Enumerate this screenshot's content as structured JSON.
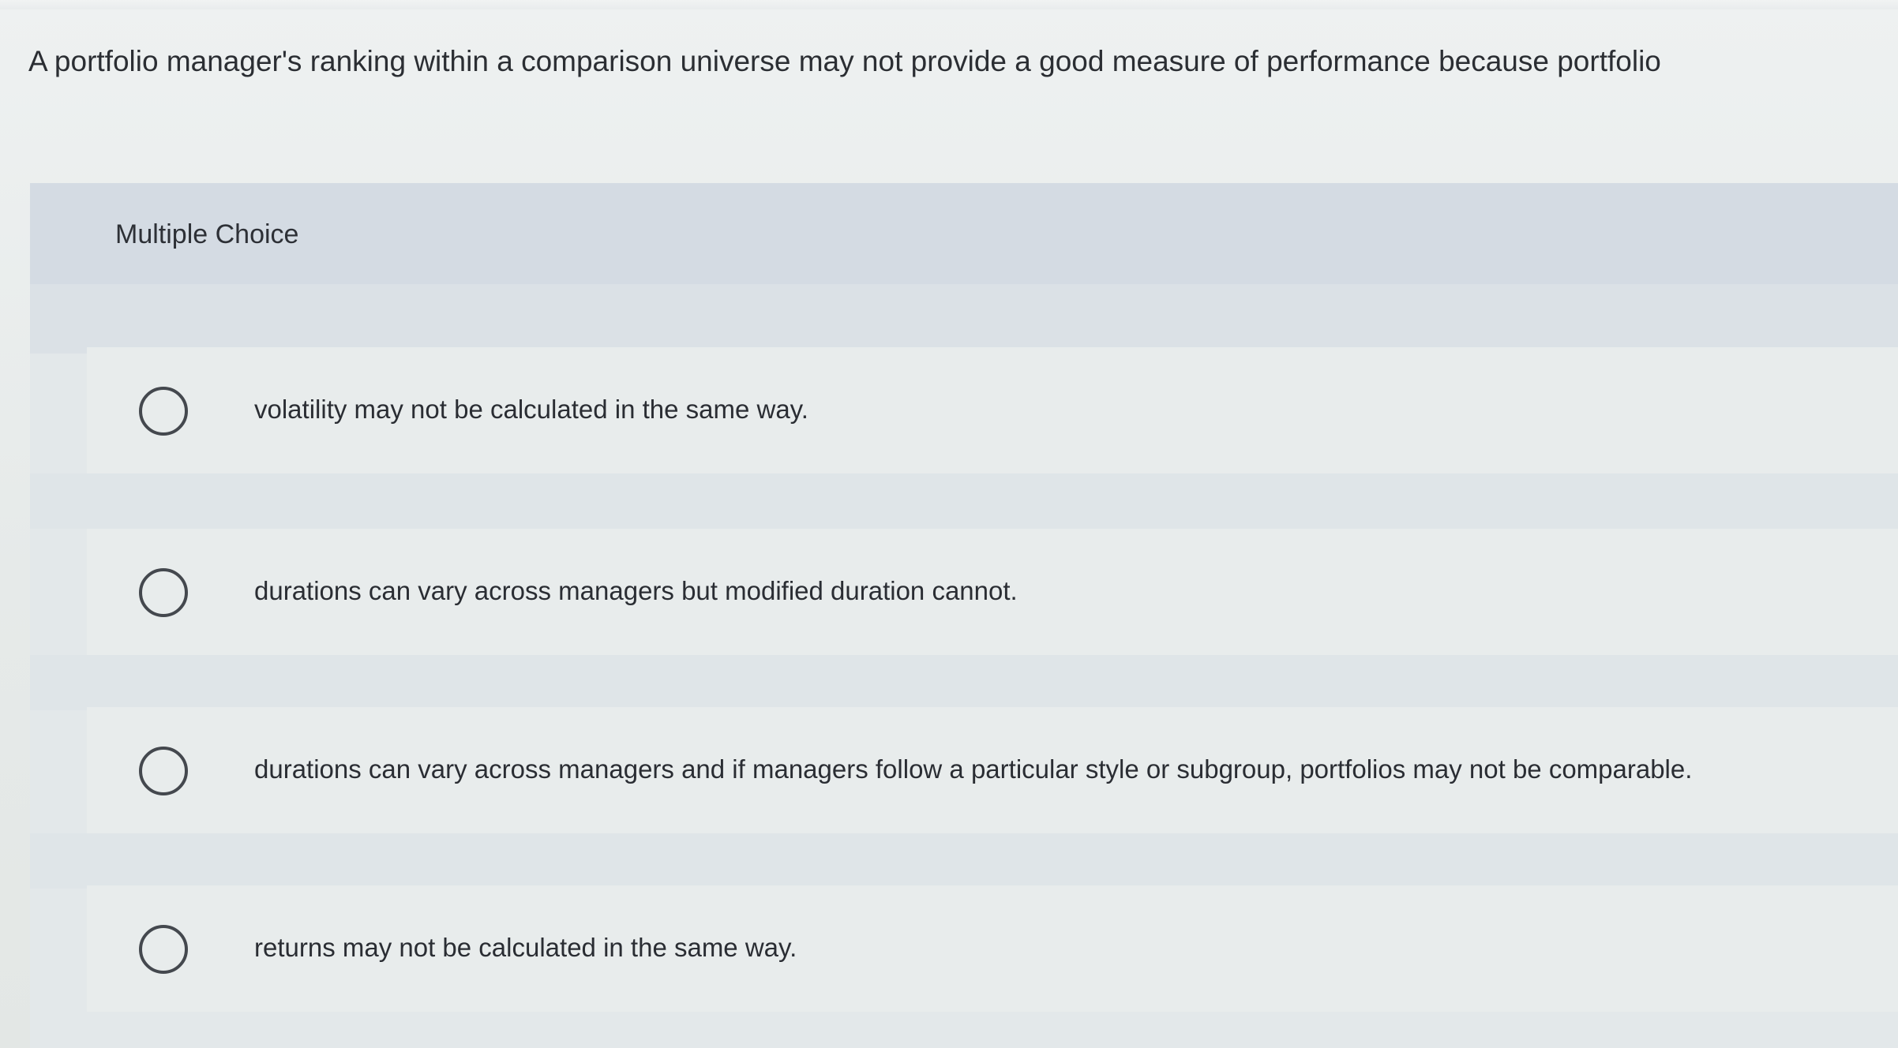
{
  "question": {
    "text": "A portfolio manager's ranking within a comparison universe may not provide a good measure of performance because portfolio"
  },
  "multiple_choice": {
    "header_label": "Multiple Choice",
    "options": [
      {
        "label": "volatility may not be calculated in the same way."
      },
      {
        "label": "durations can vary across managers but modified duration cannot."
      },
      {
        "label": "durations can vary across managers and if managers follow a particular style or subgroup, portfolios may not be comparable."
      },
      {
        "label": "returns may not be calculated in the same way."
      }
    ]
  }
}
